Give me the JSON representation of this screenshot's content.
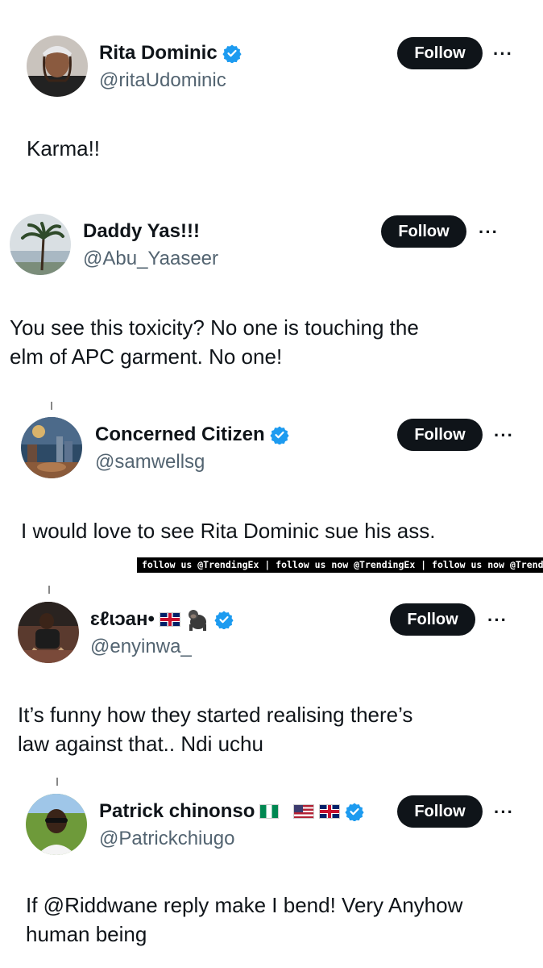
{
  "posts": [
    {
      "name": "Rita Dominic",
      "handle": "@ritaUdominic",
      "verified": true,
      "follow_label": "Follow",
      "text": "Karma!!"
    },
    {
      "name": "Daddy Yas!!!",
      "handle": "@Abu_Yaaseer",
      "verified": false,
      "follow_label": "Follow",
      "text": "You see this toxicity? No one is touching the\nelm of APC garment. No one!"
    },
    {
      "name": "Concerned Citizen",
      "handle": "@samwellsg",
      "verified": true,
      "follow_label": "Follow",
      "text": "I would love to see Rita Dominic sue his ass."
    },
    {
      "name": "ɛℓɩɔaʜ•",
      "handle": "@enyinwa_",
      "verified": true,
      "follow_label": "Follow",
      "text": "It’s funny how they started realising there’s\nlaw against that.. Ndi uchu"
    },
    {
      "name": "Patrick chinonso",
      "handle": "@Patrickchiugo",
      "verified": true,
      "follow_label": "Follow",
      "text": "If @Riddwane reply make I bend! Very Anyhow\nhuman being"
    }
  ],
  "banner": {
    "text": "follow us @TrendingEx | follow us now @TrendingEx | follow us now @TrendingEx"
  },
  "more_label": "···",
  "colors": {
    "follow_bg": "#0f1419",
    "verified_blue": "#1d9bf0",
    "handle_gray": "#536471"
  }
}
